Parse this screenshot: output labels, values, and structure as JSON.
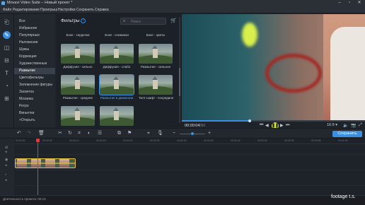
{
  "window": {
    "title": "Movavi Video Suite – Новый проект *",
    "controls": {
      "minimize": "–",
      "maximize": "▫",
      "close": "✕"
    }
  },
  "menu": [
    "Файл",
    "Редактирование",
    "Проигрыш",
    "Настройки",
    "Сохранить",
    "Справка"
  ],
  "categories": [
    "Все",
    "Избранное",
    "Популярные",
    "Наложения",
    "Шумы",
    "Коррекция",
    "Художественные",
    "Размытие",
    "Цветофильтры",
    "Затемнение фигуры",
    "Засветка",
    "Мозаика",
    "Ретро",
    "Виньетки",
    "+Открыть"
  ],
  "active_category": "Размытие",
  "filters_panel": {
    "title": "Фильтры",
    "search_placeholder": "Поиск",
    "top_labels": [
      "Боке - сердечки",
      "Боке - снежинки",
      "Боке - цветы"
    ],
    "tiles": [
      {
        "label": "Диффузия - сильно",
        "selected": false
      },
      {
        "label": "Диффузия - слабо",
        "selected": false
      },
      {
        "label": "Размытие - сильное",
        "selected": false
      },
      {
        "label": "Размытие - среднее",
        "selected": false
      },
      {
        "label": "Размытие в движении",
        "selected": true
      },
      {
        "label": "Тилт-шифт - посредине",
        "selected": false
      },
      {
        "label": "",
        "selected": false
      },
      {
        "label": "",
        "selected": false
      }
    ]
  },
  "player": {
    "timecode": "00:00:04",
    "timecode_frames": "350",
    "progress_fraction": 0.37,
    "aspect_ratio": "16:9 ▾"
  },
  "toolbar": {
    "save_label": "Сохранить",
    "zoom_fraction": 0.5
  },
  "ruler": [
    "00:00:00",
    "00:00:05",
    "00:00:10",
    "00:00:15",
    "00:00:20",
    "00:00:25",
    "00:00:30",
    "00:00:35",
    "00:00:40",
    "00:00:45",
    "00:00:50",
    "00:00:55",
    "00:01:00"
  ],
  "status": {
    "project_length": "Длительность проекта: 00:13"
  },
  "watermark": "footage t.s."
}
